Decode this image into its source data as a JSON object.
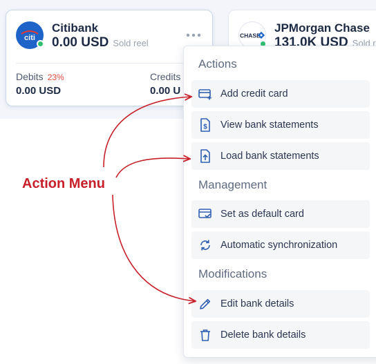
{
  "cards": [
    {
      "name": "Citibank",
      "balance": "0.00 USD",
      "sold_label": "Sold reel",
      "logo_text": "citi",
      "debits_label": "Debits",
      "debits_pct": "23%",
      "debits_value": "0.00 USD",
      "credits_label": "Credits",
      "credits_value": "0.00 U"
    },
    {
      "name": "JPMorgan Chase",
      "balance": "131.0K USD",
      "sold_label": "Sold r",
      "logo_text": "CHASE"
    }
  ],
  "menu": {
    "sections": [
      {
        "title": "Actions",
        "items": [
          {
            "label": "Add credit card",
            "icon": "credit-card-plus-icon"
          },
          {
            "label": "View bank statements",
            "icon": "dollar-document-icon"
          },
          {
            "label": "Load bank statements",
            "icon": "upload-document-icon"
          }
        ]
      },
      {
        "title": "Management",
        "items": [
          {
            "label": "Set as default card",
            "icon": "card-check-icon"
          },
          {
            "label": "Automatic synchronization",
            "icon": "sync-icon"
          }
        ]
      },
      {
        "title": "Modifications",
        "items": [
          {
            "label": "Edit bank details",
            "icon": "pencil-icon"
          },
          {
            "label": "Delete bank details",
            "icon": "trash-icon"
          }
        ]
      }
    ]
  },
  "annotation": {
    "label": "Action Menu",
    "color": "#c8202a"
  },
  "colors": {
    "accent": "#1e63c8",
    "status_online": "#2fbf71",
    "debit_pct": "#e2473b",
    "icon": "#2f5fb3"
  }
}
